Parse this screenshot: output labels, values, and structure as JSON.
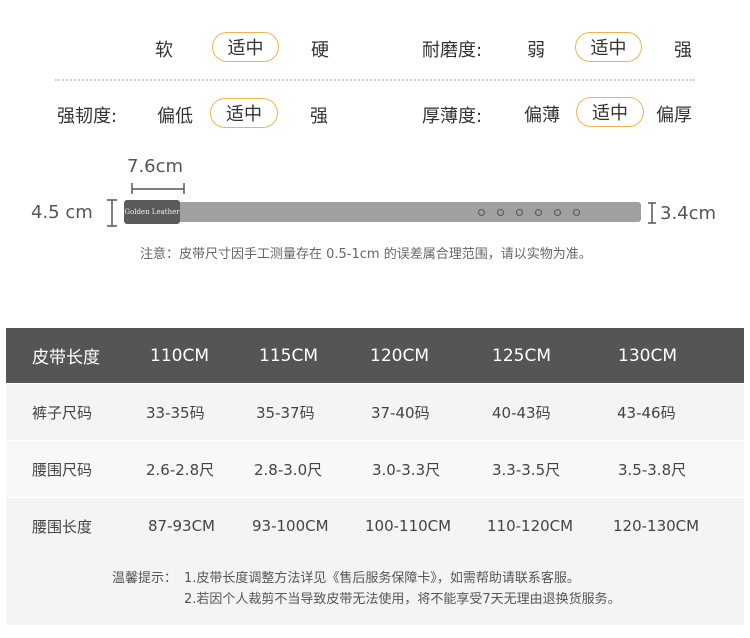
{
  "properties": {
    "softness": {
      "options": [
        "软",
        "适中",
        "硬"
      ]
    },
    "wear": {
      "label": "耐磨度:",
      "options": [
        "弱",
        "适中",
        "强"
      ]
    },
    "toughness": {
      "label": "强韧度:",
      "options": [
        "偏低",
        "适中",
        "强"
      ]
    },
    "thickness": {
      "label": "厚薄度:",
      "options": [
        "偏薄",
        "适中",
        "偏厚"
      ]
    }
  },
  "diagram": {
    "buckle_width": "7.6cm",
    "left_height": "4.5 cm",
    "right_height": "3.4cm",
    "logo_text": "Golden Leather",
    "note": "注意：皮带尺寸因手工测量存在 0.5-1cm 的误差属合理范围，请以实物为准。"
  },
  "table": {
    "headers": [
      "皮带长度",
      "110CM",
      "115CM",
      "120CM",
      "125CM",
      "130CM"
    ],
    "rows": [
      {
        "label": "裤子尺码",
        "values": [
          "33-35码",
          "35-37码",
          "37-40码",
          "40-43码",
          "43-46码"
        ]
      },
      {
        "label": "腰围尺码",
        "values": [
          "2.6-2.8尺",
          "2.8-3.0尺",
          "3.0-3.3尺",
          "3.3-3.5尺",
          "3.5-3.8尺"
        ]
      },
      {
        "label": "腰围长度",
        "values": [
          "87-93CM",
          "93-100CM",
          "100-110CM",
          "110-120CM",
          "120-130CM"
        ]
      }
    ]
  },
  "tips": {
    "prefix": "温馨提示：",
    "line1": "1.皮带长度调整方法详见《售后服务保障卡》，如需帮助请联系客服。",
    "line2": "2.若因个人裁剪不当导致皮带无法使用，将不能享受7天无理由退换货服务。"
  },
  "colors": {
    "accent": "#f0b44c",
    "header_bg": "#555555"
  }
}
